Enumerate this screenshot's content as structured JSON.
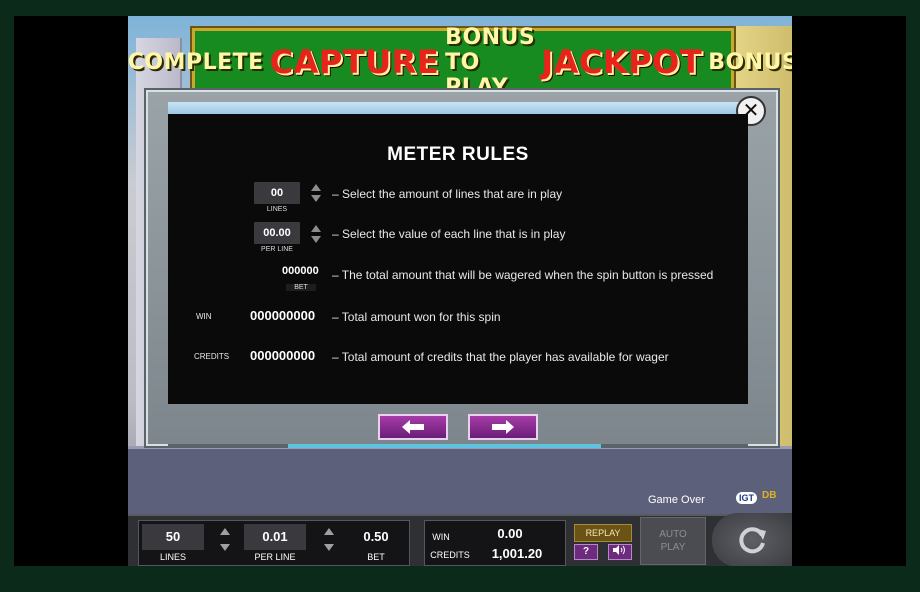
{
  "banner": {
    "part1": "COMPLETE",
    "part2": "CAPTURE",
    "part3": "BONUS TO PLAY",
    "part4": "JACKPOT",
    "part5": "BONUS"
  },
  "rules": {
    "title": "METER RULES",
    "close_icon": "✕",
    "lines_value": "00",
    "lines_label": "LINES",
    "lines_desc": "– Select the amount of lines that are in play",
    "perline_value": "00.00",
    "perline_label": "PER LINE",
    "perline_desc": "– Select the value of each line that is in play",
    "bet_value": "000000",
    "bet_label": "BET",
    "bet_desc": "– The total amount that will be wagered when the spin button is pressed",
    "win_label": "WIN",
    "win_value": "000000000",
    "win_desc": "– Total amount won for this spin",
    "credits_label": "CREDITS",
    "credits_value": "000000000",
    "credits_desc": "– Total amount of credits that the player has available for wager",
    "prev_icon": "left-arrow-icon",
    "next_icon": "right-arrow-icon",
    "progress_fraction": 0.54
  },
  "status": {
    "game_over": "Game Over",
    "brand1": "IGT",
    "brand2": "DB"
  },
  "meter": {
    "lines_value": "50",
    "lines_label": "LINES",
    "perline_value": "0.01",
    "perline_label": "PER LINE",
    "bet_value": "0.50",
    "bet_label": "BET",
    "win_label": "WIN",
    "win_value": "0.00",
    "credits_label": "CREDITS",
    "credits_value": "1,001.20",
    "replay_label": "REPLAY",
    "help_label": "?",
    "sound_icon": "speaker-icon",
    "autoplay_line1": "AUTO",
    "autoplay_line2": "PLAY",
    "spin_icon": "spin-icon"
  }
}
